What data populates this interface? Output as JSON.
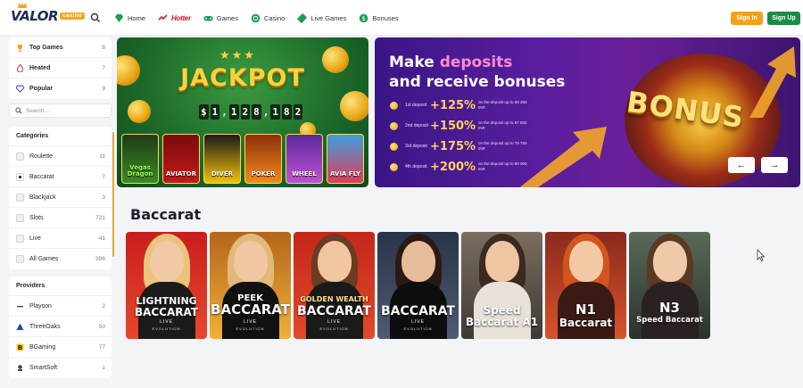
{
  "header": {
    "logo_text": "VALOR",
    "logo_badge": "casino",
    "nav": [
      {
        "label": "Home"
      },
      {
        "label": "Hotter"
      },
      {
        "label": "Games"
      },
      {
        "label": "Casino"
      },
      {
        "label": "Live Games"
      },
      {
        "label": "Bonuses"
      }
    ],
    "signin": "Sign In",
    "signup": "Sign Up"
  },
  "sidebar": {
    "top": [
      {
        "label": "Top Games",
        "count": "8"
      },
      {
        "label": "Heated",
        "count": "7"
      },
      {
        "label": "Popular",
        "count": "9"
      }
    ],
    "search_placeholder": "Search...",
    "categories_title": "Categories",
    "categories": [
      {
        "label": "Roulette",
        "count": "11"
      },
      {
        "label": "Baccarat",
        "count": "7"
      },
      {
        "label": "Blackjack",
        "count": "3"
      },
      {
        "label": "Slots",
        "count": "721"
      },
      {
        "label": "Live",
        "count": "41"
      },
      {
        "label": "All Games",
        "count": "996"
      }
    ],
    "providers_title": "Providers",
    "providers": [
      {
        "label": "Playson",
        "count": "2"
      },
      {
        "label": "ThreeOaks",
        "count": "50"
      },
      {
        "label": "BGaming",
        "count": "77"
      },
      {
        "label": "SmartSoft",
        "count": "1"
      }
    ]
  },
  "banner_jackpot": {
    "title": "JACKPOT",
    "amount_chars": [
      "$",
      "1",
      ",",
      "1",
      "2",
      "8",
      ",",
      "1",
      "8",
      "2"
    ],
    "tiles": [
      "Vegas Dragon",
      "AVIATOR",
      "DIVER",
      "POKER",
      "WHEEL",
      "AVIA FLY"
    ]
  },
  "banner_bonus": {
    "title_line1_a": "Make ",
    "title_line1_b": "deposits",
    "title_line2": "and receive bonuses",
    "rows": [
      {
        "dep": "1st deposit",
        "pct": "+125%",
        "upto": "on the deposit up to 58 250 INR"
      },
      {
        "dep": "2nd deposit",
        "pct": "+150%",
        "upto": "on the deposit up to 67 500 INR"
      },
      {
        "dep": "3rd deposit",
        "pct": "+175%",
        "upto": "on the deposit up to 78 750 INR"
      },
      {
        "dep": "4th deposit",
        "pct": "+200%",
        "upto": "on the deposit up to 90 000 INR"
      }
    ],
    "bonus_word": "BONUS",
    "prev": "←",
    "next": "→"
  },
  "section_title": "Baccarat",
  "games": [
    {
      "l1": "LIGHTNING",
      "l2": "BACCARAT",
      "live": "LIVE",
      "prov": "EVOLUTION"
    },
    {
      "l1": "PEEK",
      "l2": "BACCARAT",
      "live": "LIVE",
      "prov": "EVOLUTION"
    },
    {
      "l1": "GOLDEN WEALTH",
      "l2": "BACCARAT",
      "live": "LIVE",
      "prov": "EVOLUTION"
    },
    {
      "l1": "",
      "l2": "BACCARAT",
      "live": "LIVE",
      "prov": "EVOLUTION"
    },
    {
      "l1": "Speed",
      "l2": "Baccarat A1",
      "live": "",
      "prov": ""
    },
    {
      "l1": "N1",
      "l2": "Baccarat",
      "live": "",
      "prov": ""
    },
    {
      "l1": "N3",
      "l2": "Speed Baccarat",
      "live": "",
      "prov": ""
    }
  ],
  "colors": {
    "signin": "#f4a11b",
    "signup": "#1f8a47",
    "accent": "#e8a93a"
  }
}
